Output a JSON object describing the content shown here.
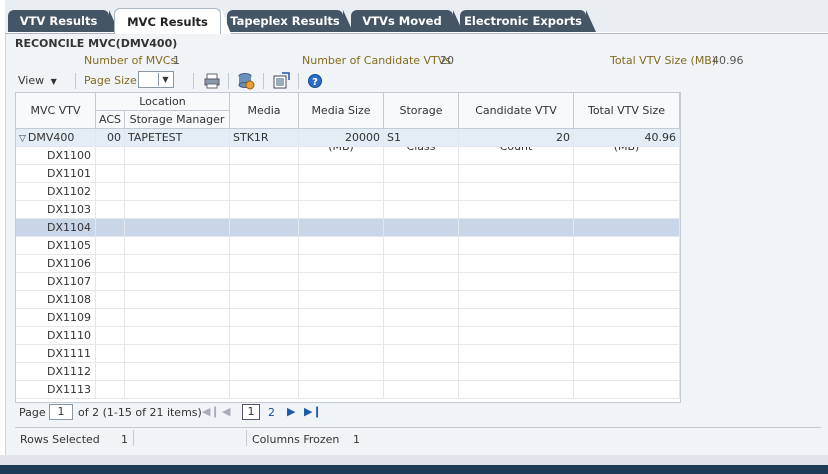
{
  "tabs": [
    {
      "label": "VTV Results"
    },
    {
      "label": "MVC Results"
    },
    {
      "label": "Tapeplex Results"
    },
    {
      "label": "VTVs Moved"
    },
    {
      "label": "Electronic Exports"
    }
  ],
  "panel": {
    "title": "RECONCILE MVC(DMV400)",
    "summary": {
      "mvcs_label": "Number of MVCs",
      "mvcs_value": "1",
      "cand_label": "Number of Candidate VTVs",
      "cand_value": "20",
      "size_label": "Total VTV Size (MB)",
      "size_value": "40.96"
    }
  },
  "toolbar": {
    "view_label": "View",
    "page_size_label": "Page Size",
    "page_size_value": ""
  },
  "table": {
    "headers": {
      "mvc_vtv": "MVC VTV",
      "location": "Location",
      "acs": "ACS",
      "storage_manager": "Storage Manager",
      "media": "Media",
      "media_size": "Media Size (MB)",
      "storage_class": "Storage Class",
      "candidate_count": "Candidate VTV Count",
      "total_size": "Total VTV Size (MB)"
    },
    "parent_row": {
      "mvc_vtv": "DMV400",
      "acs": "00",
      "storage_manager": "TAPETEST",
      "media": "STK1R",
      "media_size": "20000",
      "storage_class": "S1",
      "candidate_count": "20",
      "total_size": "40.96"
    },
    "child_rows": [
      "DX1100",
      "DX1101",
      "DX1102",
      "DX1103",
      "DX1104",
      "DX1105",
      "DX1106",
      "DX1107",
      "DX1108",
      "DX1109",
      "DX1110",
      "DX1111",
      "DX1112",
      "DX1113"
    ],
    "selected_row": "DX1104"
  },
  "pager": {
    "page_label": "Page",
    "page_value": "1",
    "of_text": "of 2 (1-15 of 21 items)",
    "page1": "1",
    "page2": "2"
  },
  "status": {
    "rows_selected_label": "Rows Selected",
    "rows_selected_value": "1",
    "columns_frozen_label": "Columns Frozen",
    "columns_frozen_value": "1"
  },
  "colors": {
    "tab_dark": "#445566",
    "selected_row": "#c9d6e8",
    "summary_label": "#826b1d"
  }
}
